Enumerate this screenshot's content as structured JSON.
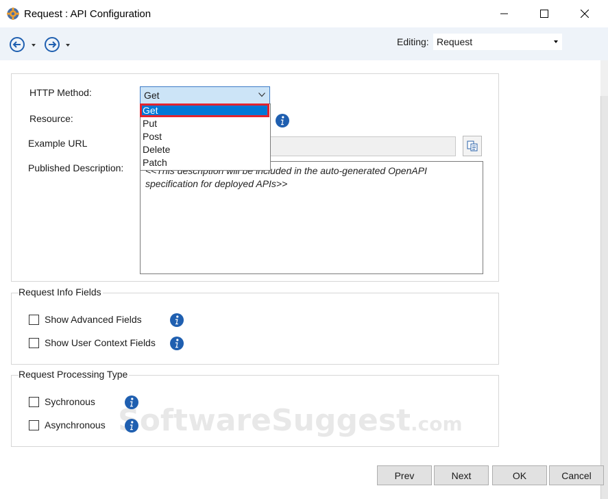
{
  "window": {
    "title": "Request : API Configuration",
    "icon": "gear-app-icon"
  },
  "toolbar": {
    "back_icon": "back-arrow-icon",
    "forward_icon": "forward-arrow-icon",
    "editing_label": "Editing:",
    "editing_value": "Request"
  },
  "main": {
    "http_method_label": "HTTP Method:",
    "http_method_value": "Get",
    "method_options": [
      "Get",
      "Put",
      "Post",
      "Delete",
      "Patch"
    ],
    "resource_label": "Resource:",
    "example_url_label": "Example URL",
    "published_description_label": "Published Description:",
    "description_placeholder": "<<This description will be included in the auto-generated OpenAPI specification for deployed APIs>>"
  },
  "request_info": {
    "title": "Request Info Fields",
    "fields": [
      {
        "label": "Show Advanced Fields",
        "checked": false
      },
      {
        "label": "Show User Context Fields",
        "checked": false
      }
    ]
  },
  "processing": {
    "title": "Request Processing Type",
    "fields": [
      {
        "label": "Sychronous",
        "checked": false
      },
      {
        "label": "Asynchronous",
        "checked": false
      }
    ]
  },
  "buttons": {
    "prev": "Prev",
    "next": "Next",
    "ok": "OK",
    "cancel": "Cancel"
  },
  "watermark": {
    "text": "SoftwareSuggest",
    "suffix": ".com"
  },
  "colors": {
    "accent": "#0078d7",
    "highlight_border": "#e2242e",
    "info_icon": "#1f5fb0",
    "toolbar_bg": "#eef3f9"
  }
}
